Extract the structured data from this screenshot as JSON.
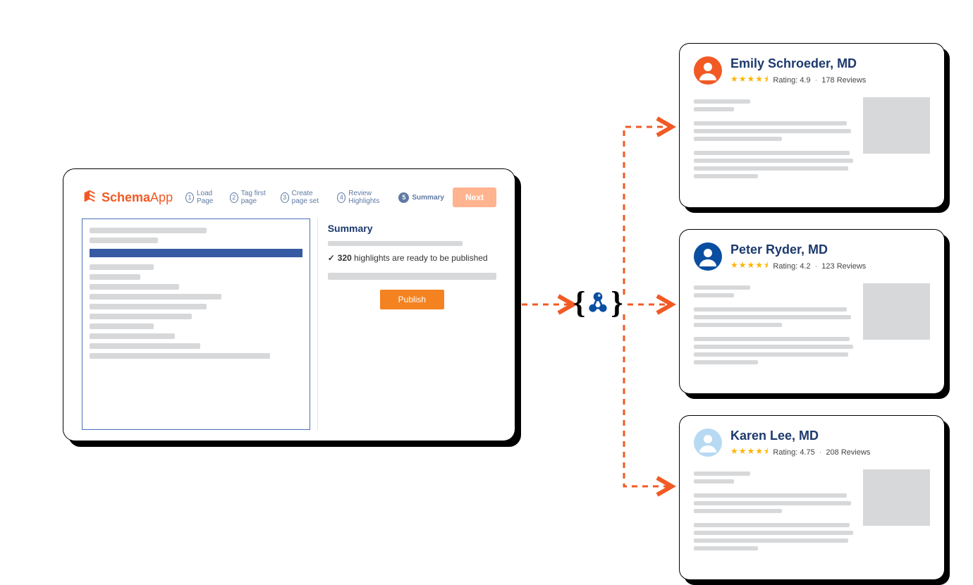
{
  "app": {
    "brand_a": "Schema",
    "brand_b": "App",
    "steps": [
      {
        "num": "1",
        "label": "Load Page"
      },
      {
        "num": "2",
        "label": "Tag first page"
      },
      {
        "num": "3",
        "label": "Create page set"
      },
      {
        "num": "4",
        "label": "Review Highlights"
      },
      {
        "num": "5",
        "label": "Summary"
      }
    ],
    "next_label": "Next",
    "summary_title": "Summary",
    "highlight_text": " highlights are ready to be published",
    "highlight_count": "320",
    "publish_label": "Publish"
  },
  "profiles": [
    {
      "name": "Emily Schroeder, MD",
      "rating_label": "Rating: 4.9",
      "reviews": "178 Reviews",
      "avatar_color": "#F15A24"
    },
    {
      "name": "Peter Ryder, MD",
      "rating_label": "Rating: 4.2",
      "reviews": "123 Reviews",
      "avatar_color": "#0a4ea2"
    },
    {
      "name": "Karen Lee, MD",
      "rating_label": "Rating: 4.75",
      "reviews": "208 Reviews",
      "avatar_color": "#b7daf2"
    }
  ],
  "stars_glyph": "★★★★⯨"
}
